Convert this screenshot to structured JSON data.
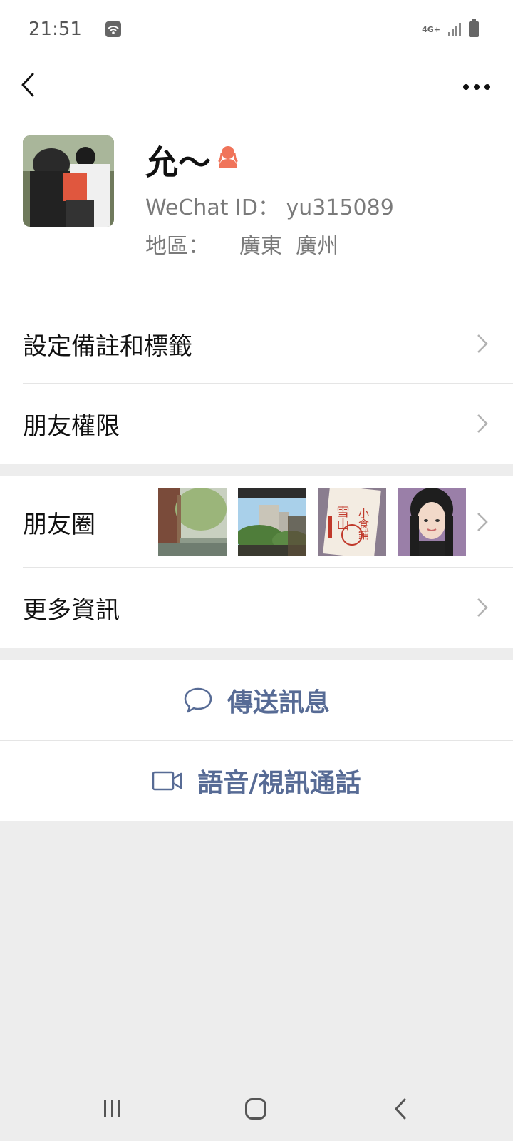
{
  "status_bar": {
    "time": "21:51",
    "network": "4G+",
    "icons": [
      "wifi-icon",
      "signal-icon",
      "battery-icon"
    ]
  },
  "nav": {
    "back_icon": "chevron-left-icon",
    "more_icon": "more-dots-icon"
  },
  "profile": {
    "nickname": "允～",
    "gender_icon": "female-icon",
    "wechat_id_label": "WeChat ID：",
    "wechat_id": "yu315089",
    "region_label": "地區：",
    "region_province": "廣東",
    "region_city": "廣州"
  },
  "menu": {
    "set_remark": "設定備註和標籤",
    "friend_permissions": "朋友權限",
    "moments": "朋友圈",
    "more_info": "更多資訊"
  },
  "moments_thumbs": {
    "thumb3_text_a": "小食鋪",
    "thumb3_text_b": "雪山"
  },
  "actions": {
    "send_message": "傳送訊息",
    "call": "語音/視訊通話"
  },
  "colors": {
    "link": "#576b95",
    "background": "#ededed",
    "gender_icon": "#f0745a"
  }
}
